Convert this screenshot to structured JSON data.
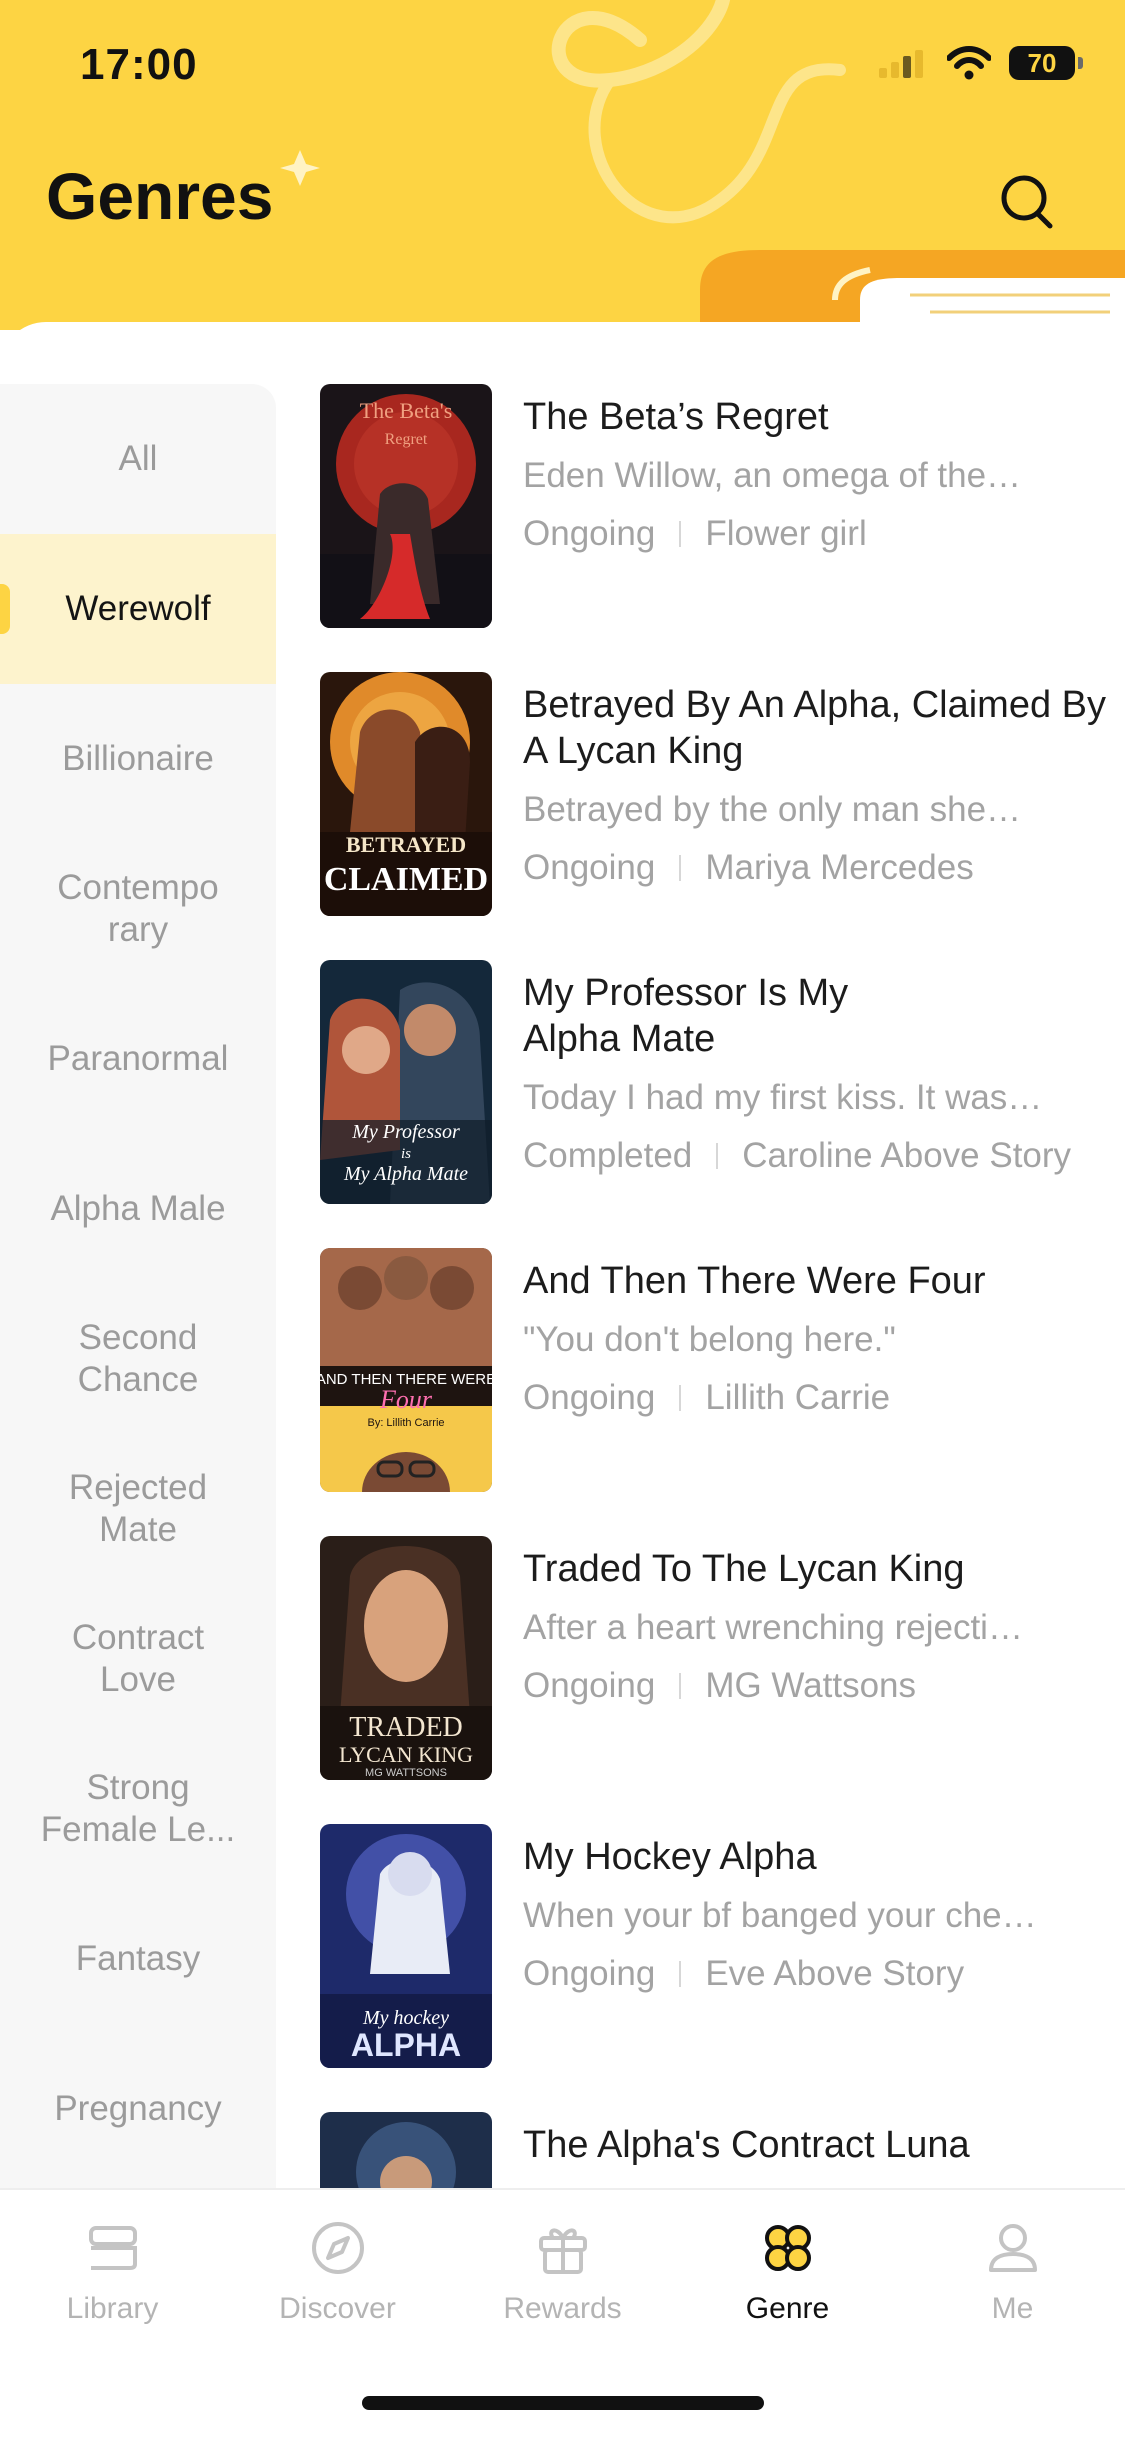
{
  "status_bar": {
    "time": "17:00",
    "battery": "70"
  },
  "header": {
    "title": "Genres",
    "search_icon": "search-icon"
  },
  "colors": {
    "brand_yellow": "#fdd443",
    "active_bg": "#fdf3cd",
    "muted_text": "#a3a3a3"
  },
  "genres": [
    {
      "label": "All",
      "active": false
    },
    {
      "label": "Werewolf",
      "active": true
    },
    {
      "label": "Billionaire",
      "active": false
    },
    {
      "label": "Contemporary",
      "active": false
    },
    {
      "label": "Paranormal",
      "active": false
    },
    {
      "label": "Alpha Male",
      "active": false
    },
    {
      "label": "Second Chance",
      "active": false
    },
    {
      "label": "Rejected Mate",
      "active": false
    },
    {
      "label": "Contract Love",
      "active": false
    },
    {
      "label": "Strong Female Le...",
      "active": false
    },
    {
      "label": "Fantasy",
      "active": false
    },
    {
      "label": "Pregnancy",
      "active": false
    }
  ],
  "books": [
    {
      "title": "The Beta’s Regret",
      "description": "Eden Willow, an omega of the…",
      "status": "Ongoing",
      "author": "Flower girl",
      "cover_text": [
        "The Beta's",
        "Regret"
      ]
    },
    {
      "title": "Betrayed By An Alpha, Claimed By A Lycan King",
      "description": "Betrayed by the only man she…",
      "status": "Ongoing",
      "author": "Mariya Mercedes",
      "cover_text": [
        "BETRAYED",
        "CLAIMED"
      ]
    },
    {
      "title": "My Professor Is My Alpha Mate",
      "description": "Today I had my first kiss. It was…",
      "status": "Completed",
      "author": "Caroline Above Story",
      "cover_text": [
        "My Professor",
        "is",
        "My Alpha Mate"
      ]
    },
    {
      "title": "And Then There Were Four",
      "description": "\"You don't belong here.\"",
      "status": "Ongoing",
      "author": "Lillith Carrie",
      "cover_text": [
        "AND THEN THERE WERE",
        "Four",
        "By: Lillith Carrie"
      ]
    },
    {
      "title": "Traded To The Lycan King",
      "description": "After a heart wrenching rejecti…",
      "status": "Ongoing",
      "author": "MG Wattsons",
      "cover_text": [
        "TRADED",
        "LYCAN KING",
        "MG WATTSONS"
      ]
    },
    {
      "title": "My Hockey Alpha",
      "description": "When your bf banged your che…",
      "status": "Ongoing",
      "author": "Eve Above Story",
      "cover_text": [
        "My hockey",
        "ALPHA"
      ]
    },
    {
      "title": "The Alpha's Contract Luna",
      "description": "",
      "status": "",
      "author": "",
      "cover_text": []
    }
  ],
  "tabbar": {
    "items": [
      {
        "label": "Library",
        "icon": "library-icon",
        "active": false
      },
      {
        "label": "Discover",
        "icon": "compass-icon",
        "active": false
      },
      {
        "label": "Rewards",
        "icon": "gift-icon",
        "active": false
      },
      {
        "label": "Genre",
        "icon": "genre-grid-icon",
        "active": true
      },
      {
        "label": "Me",
        "icon": "user-icon",
        "active": false
      }
    ]
  }
}
